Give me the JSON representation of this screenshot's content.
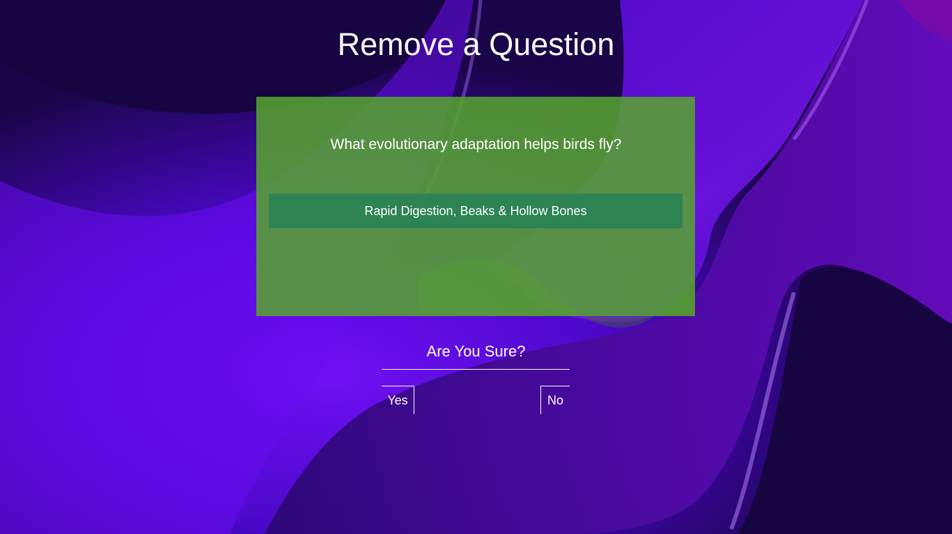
{
  "page": {
    "title": "Remove a Question"
  },
  "question": {
    "text": "What evolutionary adaptation helps birds fly?",
    "answer": "Rapid Digestion, Beaks & Hollow Bones"
  },
  "confirm": {
    "prompt": "Are You Sure?",
    "yes_label": "Yes",
    "no_label": "No"
  },
  "colors": {
    "background_dark": "#170541",
    "background_purple": "#6a0df0",
    "card_green": "#56a52f",
    "answer_green": "#2a8255",
    "text": "#ffffff"
  }
}
